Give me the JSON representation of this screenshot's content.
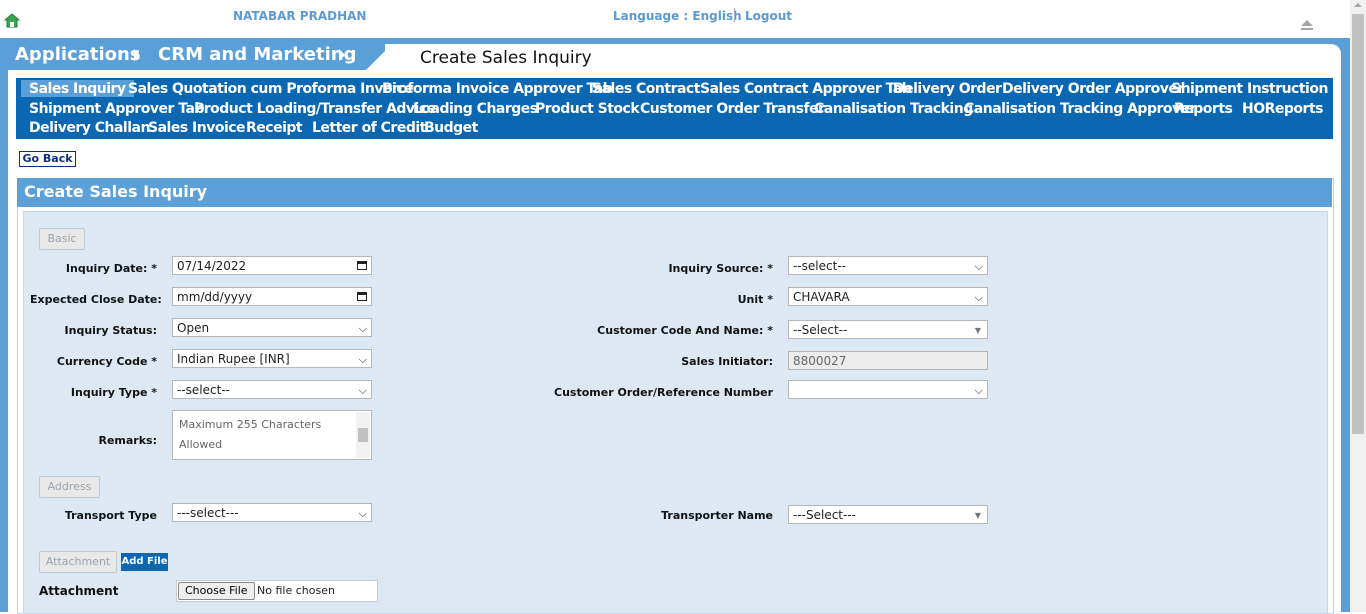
{
  "header": {
    "user_name": "NATABAR PRADHAN",
    "language_label": "Language : English",
    "logout_label": "Logout"
  },
  "breadcrumb": {
    "items": [
      "Applications",
      "CRM and Marketing"
    ],
    "page_title": "Create Sales Inquiry"
  },
  "menu": {
    "items": [
      "Sales Inquiry",
      "Sales Quotation cum Proforma Invoice",
      "Proforma Invoice Approver Tab",
      "Sales Contract",
      "Sales Contract Approver Tab",
      "Delivery Order",
      "Delivery Order Approver",
      "Shipment Instruction",
      "Shipment Approver Tab",
      "Product Loading/Transfer Advice",
      "Loading Charges",
      "Product Stock",
      "Customer Order Transfer",
      "Canalisation Tracking",
      "Canalisation Tracking Approver",
      "Reports",
      "HOReports",
      "Delivery Challan",
      "Sales Invoice",
      "Receipt",
      "Letter of Credit",
      "Budget"
    ],
    "active": "Sales Inquiry"
  },
  "go_back_label": "Go Back",
  "panel_title": "Create Sales Inquiry",
  "sections": {
    "basic": "Basic",
    "address": "Address",
    "attachment": "Attachment"
  },
  "form": {
    "inquiry_date": {
      "label": "Inquiry Date: *",
      "value": "07/14/2022"
    },
    "expected_close_date": {
      "label": "Expected Close Date:",
      "value": "mm/dd/yyyy"
    },
    "inquiry_status": {
      "label": "Inquiry Status:",
      "value": "Open"
    },
    "currency_code": {
      "label": "Currency Code *",
      "value": "Indian Rupee [INR]"
    },
    "inquiry_type": {
      "label": "Inquiry Type *",
      "value": "--select--"
    },
    "remarks": {
      "label": "Remarks:",
      "placeholder": "Maximum 255 Characters Allowed"
    },
    "inquiry_source": {
      "label": "Inquiry Source: *",
      "value": "--select--"
    },
    "unit": {
      "label": "Unit *",
      "value": "CHAVARA"
    },
    "customer_code": {
      "label": "Customer Code And Name: *",
      "value": "--Select--"
    },
    "sales_initiator": {
      "label": "Sales Initiator:",
      "value": "8800027"
    },
    "customer_order_ref": {
      "label": "Customer Order/Reference Number",
      "value": ""
    },
    "transport_type": {
      "label": "Transport Type",
      "value": "---select---"
    },
    "transporter_name": {
      "label": "Transporter Name",
      "value": "---Select---"
    },
    "attachment": {
      "label": "Attachment",
      "add_file": "Add File",
      "choose_file": "Choose File",
      "no_file": "No file chosen"
    }
  }
}
